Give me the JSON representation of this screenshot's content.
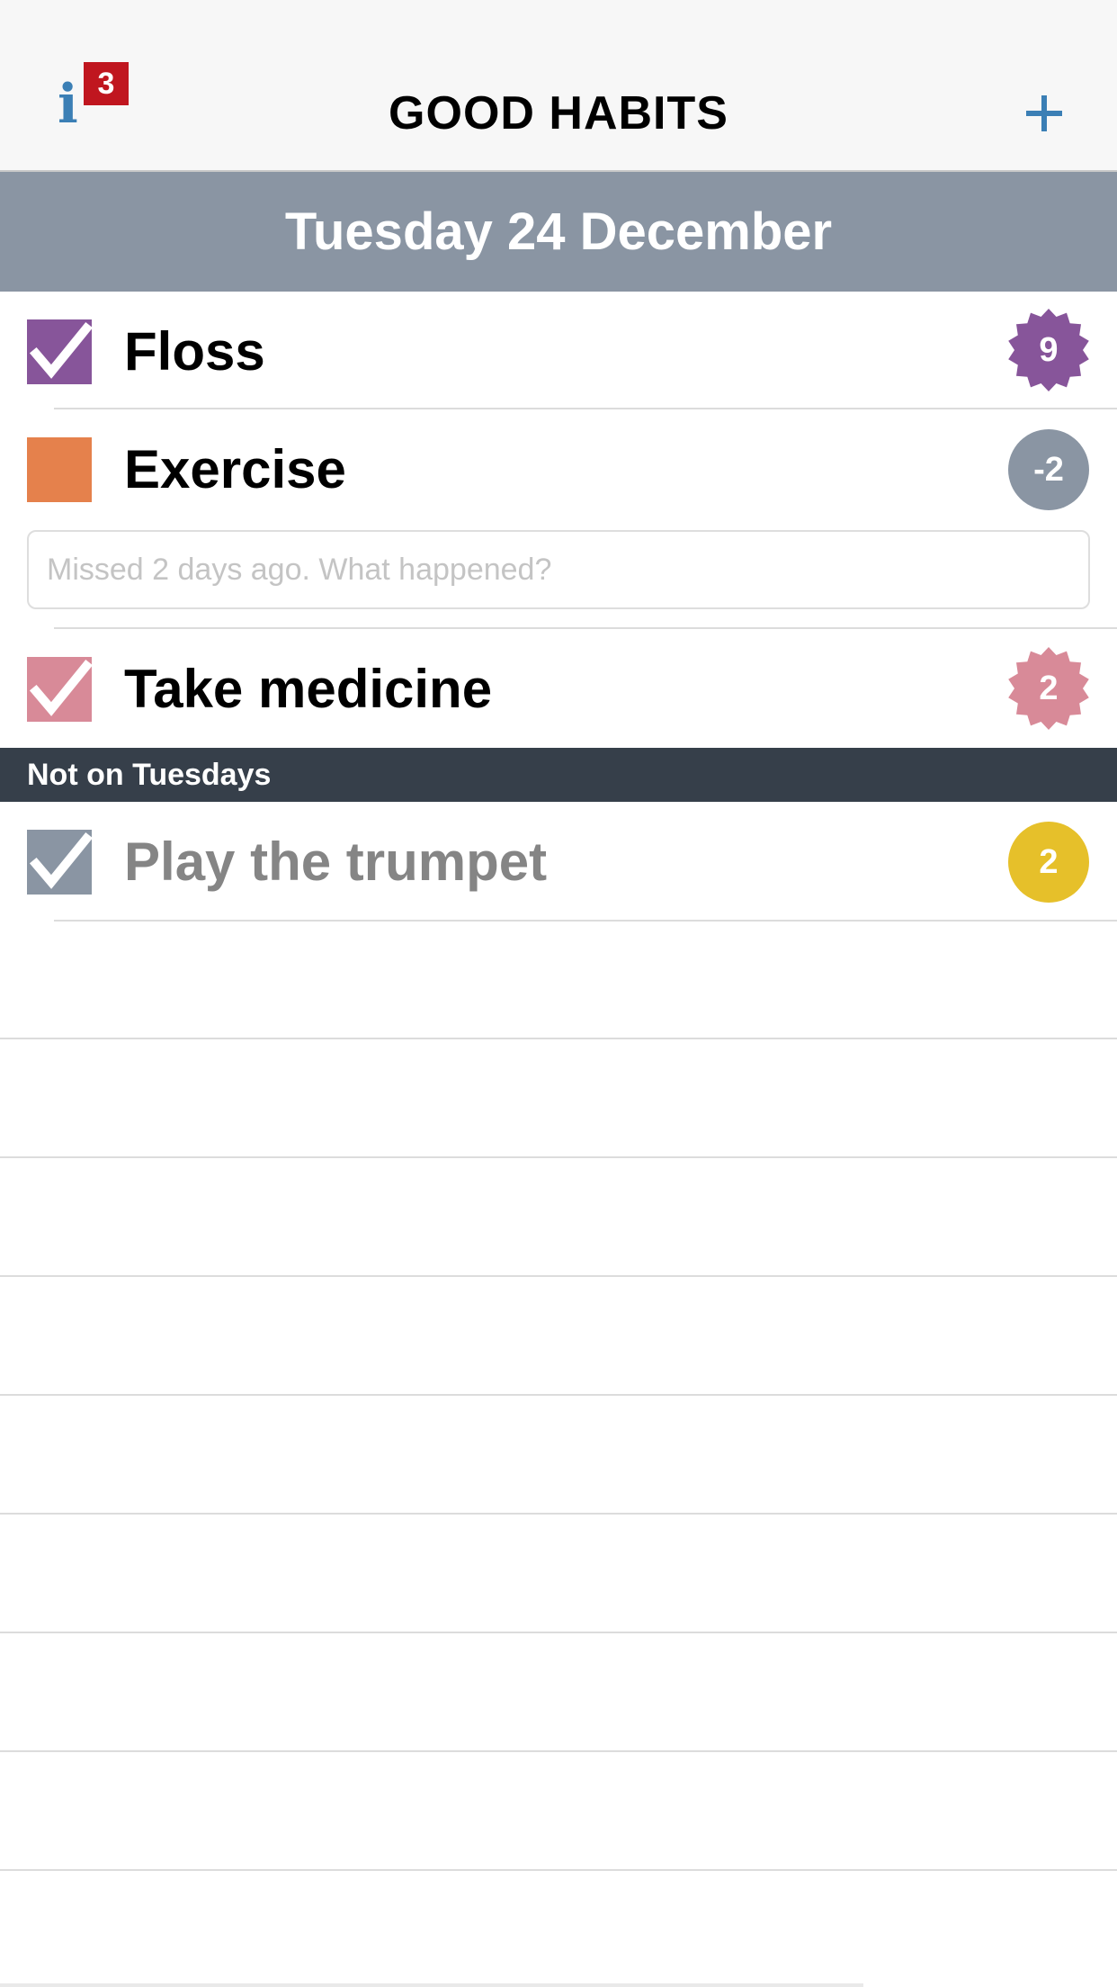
{
  "navbar": {
    "title": "GOOD HABITS",
    "info_icon": "info-icon",
    "info_badge_count": "3",
    "add_icon": "plus-icon",
    "accent_color": "#3b7fb5",
    "badge_color": "#c0161f"
  },
  "date_header": {
    "text": "Tuesday 24 December",
    "color": "#8a95a3"
  },
  "habits": [
    {
      "label": "Floss",
      "checked": true,
      "color": "#87559a",
      "count": "9",
      "count_shape": "starburst"
    },
    {
      "label": "Exercise",
      "checked": false,
      "color": "#e5814c",
      "count": "-2",
      "count_color": "#8a95a3",
      "count_shape": "circle"
    },
    {
      "label": "Take medicine",
      "checked": true,
      "color": "#d88a98",
      "count": "2",
      "count_shape": "starburst"
    }
  ],
  "missed_note": {
    "placeholder": "Missed 2 days ago. What happened?",
    "value": ""
  },
  "section": {
    "title": "Not on Tuesdays",
    "color": "#363f4a"
  },
  "inactive_habits": [
    {
      "label": "Play the trumpet",
      "checked": true,
      "color": "#8a95a3",
      "count": "2",
      "count_color": "#e6c02a",
      "count_shape": "circle"
    }
  ]
}
